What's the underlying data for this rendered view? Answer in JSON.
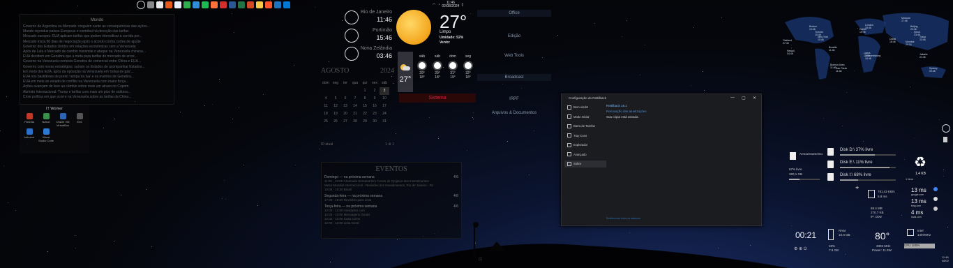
{
  "taskbar": {
    "icons": [
      "windows-logo",
      "notepad",
      "chrome",
      "notion",
      "office",
      "whatsapp",
      "edge",
      "spotify",
      "firefox",
      "opera",
      "word",
      "excel",
      "powerpoint",
      "file-explorer",
      "brave",
      "mail",
      "outlook"
    ],
    "tray": {
      "time": "11:46",
      "date": "02/08/2024"
    }
  },
  "news": {
    "title": "Mundo",
    "lines": [
      "Governo de Argentina ou Mercado: ninguém cante as consequências das ações...",
      "Mundo reproduz países Europeus e contribui há devoção das tarifas",
      "Mercado europeu: EUA aplicam tarifas que podem intensificar a corrida por...",
      "Mercado inicia 90 dias de negociação após o acordo contra cortes de ajuste",
      "Governo dos Estados Unidos em relações econômicas com a Venezuela",
      "Após de Lula o Mercado de cambio transmite o ataque na Venezuela chinesa...",
      "EUA decidem em Genebra que a meta para tarifas do mercado de arroz...",
      "Governo na Venezuela contesta Genebra de comercial entre China e EUA...",
      "Governo com novas estratégias: saíram os Estados de acompanhar Estados...",
      "Em meio dos EUA, após da oposição na Venezuela em 'bolsa de gás'...",
      "EUA nos bastidores de ponto 'rampa da lua' e os eventos de Genebra...",
      "EUA em meio ao estado de conflito na Venezuela com maior força...",
      "Ações avançam de leve ao câmbio sobre mais um atraso no Copom",
      "Abrindo Internacional: Trump e tarifas com mais um pico de salários...",
      "Crise política em que ocorre na Venezuela sobre as tarifas da China..."
    ]
  },
  "it_worker": {
    "title": "IT Worker",
    "apps": [
      {
        "label": "FileZilla",
        "color": "#c0392b",
        "icon": "filezilla-icon"
      },
      {
        "label": "Notion",
        "color": "#3a8f4a",
        "icon": "notion-icon"
      },
      {
        "label": "Oracle VM VirtualBox",
        "color": "#2d64b3",
        "icon": "virtualbox-icon"
      },
      {
        "label": "Ebs",
        "color": "#555",
        "icon": "ebs-icon"
      },
      {
        "label": "kdhome",
        "color": "#2a6fc9",
        "icon": "kd-icon"
      },
      {
        "label": "Visual Studio Code",
        "color": "#2d7bd2",
        "icon": "vscode-icon"
      }
    ]
  },
  "clocks": [
    {
      "city": "Rio de Janeiro",
      "time": "11:46"
    },
    {
      "city": "Portimão",
      "time": "15:46"
    },
    {
      "city": "Nova Zelândia",
      "time": "03:46"
    }
  ],
  "weather": {
    "temp": "27°",
    "condition": "Limpo",
    "humidity_label": "Umidade:",
    "humidity": "52%",
    "wind_label": "Vento:",
    "wind": "",
    "today_temp": "27°",
    "forecast": [
      {
        "day": "sáb",
        "high": "29°",
        "low": "18°"
      },
      {
        "day": "sáb",
        "high": "29°",
        "low": "18°"
      },
      {
        "day": "dom",
        "high": "31°",
        "low": "19°"
      },
      {
        "day": "seg",
        "high": "32°",
        "low": "18°"
      }
    ]
  },
  "calendar": {
    "month": "AGOSTO",
    "year": "2024",
    "weekdays": [
      "dom",
      "seg",
      "ter",
      "qua",
      "qui",
      "sex",
      "sáb"
    ],
    "days": [
      "",
      "",
      "",
      "",
      "1",
      "2",
      "3",
      "4",
      "5",
      "6",
      "7",
      "8",
      "9",
      "10",
      "11",
      "12",
      "13",
      "14",
      "15",
      "16",
      "17",
      "18",
      "19",
      "20",
      "21",
      "22",
      "23",
      "24",
      "25",
      "26",
      "27",
      "28",
      "29",
      "30",
      "31"
    ],
    "footer_left": "ID atual",
    "footer_right": "1 ⚙ 1"
  },
  "sistema_label": "Sistema",
  "events": {
    "title": "EVENTOS",
    "groups": [
      {
        "header": "Domingo — na próxima semana",
        "count": "4/6",
        "lines": [
          "11:00 - 13:00 Chamada Semanal Em Forum de Projetos dos Investimentos",
          "Mesa Mundial Internacional - Revisões dos Investimentos, Rio de Janeiro - RJ",
          "10:00 - 10:30 Brasil"
        ]
      },
      {
        "header": "Segunda-feira — na próxima semana",
        "count": "4/6",
        "lines": [
          "17:30 - 18:30 Revisões para Lista"
        ]
      },
      {
        "header": "Terça-feira — na próxima semana",
        "count": "4/6",
        "lines": [
          "12:00 - 13:00 Atividades com",
          "12:00 - 13:00 Mensagens Gerais",
          "12:00 - 13:00 Casa Cristo",
          "12:00 - 13:00 Lista Geral"
        ]
      }
    ]
  },
  "links": {
    "office": "Office",
    "edicao": "Edição",
    "webtools": "Web Tools",
    "broadcast": "Broadcast",
    "irpf": "IRPF",
    "arquivos": "Arquivos & Documentos"
  },
  "dialog": {
    "title": "Configuração do Rettilback",
    "app_name": "Rettilback 18.1",
    "app_sub": "Renovação das atualizações",
    "status": "Sua cópia está ativada.",
    "nav": [
      "Bem-vindo!",
      "Modo Iniciar",
      "Barra de Tarefas",
      "Tray icons",
      "Explorador",
      "Avançado",
      "Sobre"
    ],
    "selected": 6,
    "footer_link": "Redirecionar todos os sistemas"
  },
  "world_cities": [
    {
      "name": "Oakland",
      "time": "07:46"
    },
    {
      "name": "Boston",
      "time": "10:46"
    },
    {
      "name": "New York",
      "time": "10:46"
    },
    {
      "name": "Toronto",
      "time": "10:46"
    },
    {
      "name": "London",
      "time": "15:46"
    },
    {
      "name": "Dublin",
      "time": "15:46"
    },
    {
      "name": "Moscow",
      "time": "17:46"
    },
    {
      "name": "Lagos",
      "time": "15:46"
    },
    {
      "name": "Dubai",
      "time": "18:46"
    },
    {
      "name": "Mumbai",
      "time": "20:16"
    },
    {
      "name": "Beijing",
      "time": "22:46"
    },
    {
      "name": "Tokyo",
      "time": "23:46"
    },
    {
      "name": "Seoul",
      "time": "23:46"
    },
    {
      "name": "Jakarta",
      "time": "21:46"
    },
    {
      "name": "Sydney",
      "time": "00:46"
    },
    {
      "name": "Sao Paulo",
      "time": "11:46"
    },
    {
      "name": "Brasilia",
      "time": "11:46"
    },
    {
      "name": "Buenos Aires",
      "time": "11:46"
    },
    {
      "name": "Johannesburg",
      "time": "16:46"
    },
    {
      "name": "Hawaii",
      "time": "04:46"
    }
  ],
  "sysmon": {
    "bin_label": "Armazenamento",
    "bin_free": "67% livre",
    "bin_size": "320,1 GB",
    "disks": [
      {
        "label": "Disk D:\\ 37% livre",
        "fill": 63
      },
      {
        "label": "Disk E:\\ 11% livre",
        "fill": 89
      },
      {
        "label": "Disk I:\\ 68% livre",
        "fill": 32
      }
    ],
    "recycle_size": "1.4 KB",
    "recycle_items": "1 Item",
    "net_down": "781.42 KB/s",
    "net_up": "5.8 ms",
    "net_total": "68.4 MB",
    "net_total2": "270.7 KB",
    "net_ip": "IP: Dow",
    "pings": [
      {
        "value": "13 ms",
        "host": "google.com"
      },
      {
        "value": "13 ms",
        "host": "bing.com"
      },
      {
        "value": "4 ms",
        "host": "local.com"
      }
    ],
    "clock": "00:21",
    "ram_label": "RAM",
    "ram_total": "16.0 GB",
    "ram_pct": "48%",
    "ram_used": "7.8 GB",
    "cpu_temp": "80°",
    "cpu_freq": "3302 MHz",
    "cpu_power": "Power: 11.6W",
    "gpu_label": "Intel",
    "gpu_sub": "1407MHz",
    "cpu_load": "CPU 100%"
  },
  "colors": {
    "accent": "#4aa3ff",
    "sistema": "#d02440",
    "dialog_bg": "#1b1c20"
  }
}
